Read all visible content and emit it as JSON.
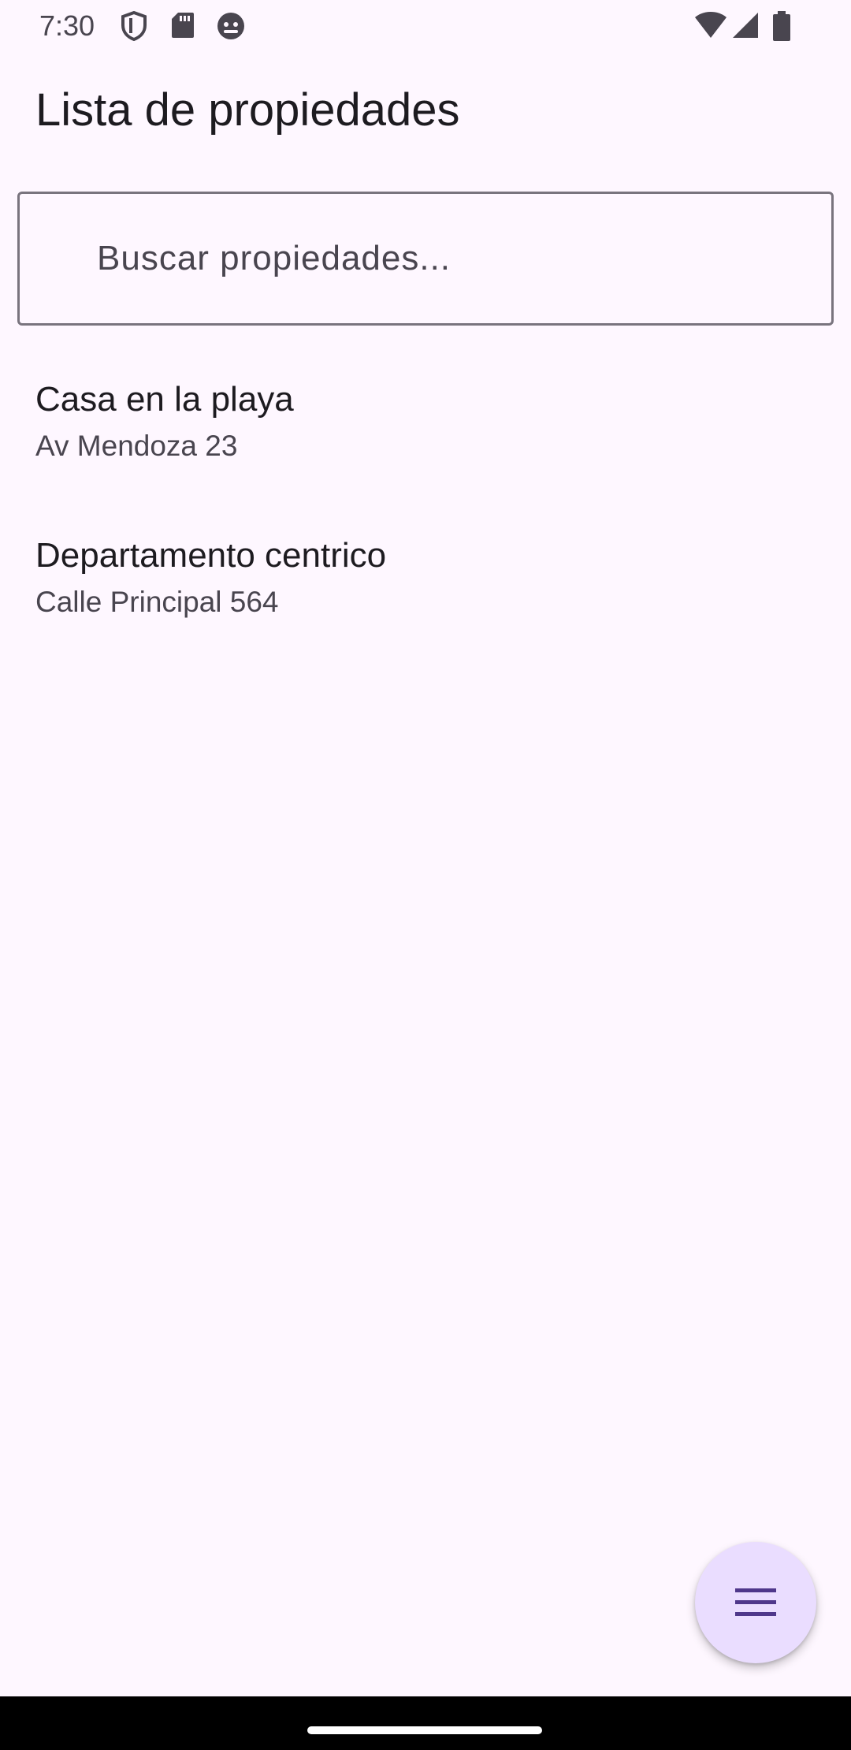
{
  "status_bar": {
    "time": "7:30",
    "left_icons": [
      "shield-icon",
      "sd-card-icon",
      "android-debug-icon"
    ],
    "right_icons": [
      "wifi-icon",
      "signal-icon",
      "battery-icon"
    ]
  },
  "header": {
    "title": "Lista de propiedades"
  },
  "search": {
    "placeholder": "Buscar propiedades...",
    "value": ""
  },
  "properties": [
    {
      "name": "Casa en la playa",
      "address": "Av Mendoza 23"
    },
    {
      "name": "Departamento centrico",
      "address": "Calle Principal 564"
    }
  ],
  "fab": {
    "icon": "menu-icon"
  },
  "colors": {
    "background": "#FEF7FF",
    "fab_background": "#EADDFF",
    "fab_icon": "#4F378B",
    "outline": "#79747E",
    "text_primary": "#1D1B20",
    "text_secondary": "#49454F"
  }
}
